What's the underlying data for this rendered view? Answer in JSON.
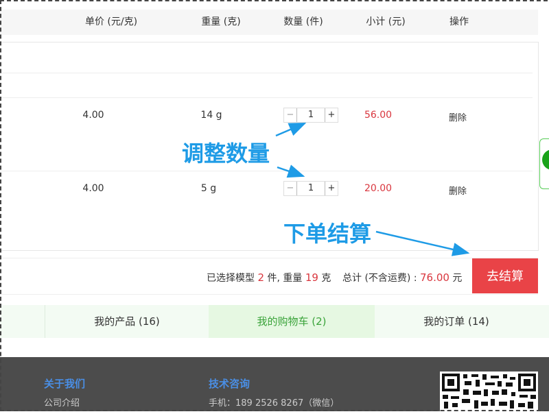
{
  "table_header": {
    "unit_price": "单价 (元/克)",
    "weight": "重量 (克)",
    "quantity": "数量 (件)",
    "subtotal": "小计 (元)",
    "actions": "操作"
  },
  "items": [
    {
      "unit_price": "4.00",
      "weight": "14 g",
      "quantity": "1",
      "subtotal": "56.00",
      "delete_label": "删除",
      "minus": "−",
      "plus": "+"
    },
    {
      "unit_price": "4.00",
      "weight": "5 g",
      "quantity": "1",
      "subtotal": "20.00",
      "delete_label": "删除",
      "minus": "−",
      "plus": "+"
    }
  ],
  "annotations": {
    "adjust_quantity": "调整数量",
    "place_order": "下单结算"
  },
  "summary": {
    "selected_prefix": "已选择模型",
    "selected_count": "2",
    "pieces_weight": "件, 重量",
    "weight_value": "19",
    "weight_unit": "克",
    "total_label": "总计 (不含运费) :",
    "total_value": "76.00",
    "currency": "元",
    "checkout_label": "去结算"
  },
  "tabs": [
    {
      "label": "我的产品 (16)"
    },
    {
      "label": "我的购物车 (2)"
    },
    {
      "label": "我的订单 (14)"
    }
  ],
  "footer": {
    "about_title": "关于我们",
    "about_link": "公司介绍",
    "tech_title": "技术咨询",
    "tech_phone": "手机：189 2526 8267（微信）"
  },
  "colors": {
    "accent_red": "#e94347",
    "annotation_blue": "#1e9be6",
    "active_tab_green": "#3aa33a"
  }
}
